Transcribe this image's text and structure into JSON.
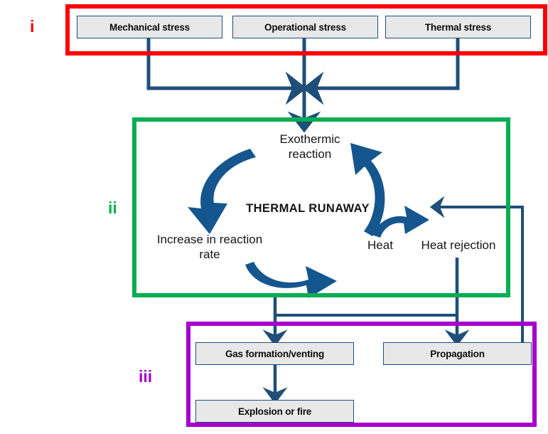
{
  "diagram": {
    "title": "Thermal runaway causes and consequences flow diagram",
    "colors": {
      "stage_i": "#fe0000",
      "stage_ii": "#09ad52",
      "stage_iii": "#a600cc",
      "connector": "#1f4e79",
      "box_fill": "#e8e8e8",
      "box_border": "#1f4e79",
      "text": "#151515"
    }
  },
  "stages": {
    "i": {
      "label": "i"
    },
    "ii": {
      "label": "ii"
    },
    "iii": {
      "label": "iii"
    }
  },
  "boxes": {
    "mechanical_stress": "Mechanical stress",
    "operational_stress": "Operational stress",
    "thermal_stress": "Thermal stress",
    "gas_formation": "Gas formation/venting",
    "propagation": "Propagation",
    "explosion": "Explosion or fire"
  },
  "cycle": {
    "center": "THERMAL  RUNAWAY",
    "exothermic": "Exothermic\nreaction",
    "exothermic_line1": "Exothermic",
    "exothermic_line2": "reaction",
    "increase_line1": "Increase  in reaction",
    "increase_line2": "rate",
    "heat": "Heat",
    "heat_rejection": "Heat rejection"
  },
  "chart_data": {
    "type": "diagram",
    "title": "Thermal runaway mechanism",
    "nodes": [
      {
        "id": "mechanical_stress",
        "label": "Mechanical stress",
        "stage": "i"
      },
      {
        "id": "operational_stress",
        "label": "Operational stress",
        "stage": "i"
      },
      {
        "id": "thermal_stress",
        "label": "Thermal stress",
        "stage": "i"
      },
      {
        "id": "exothermic",
        "label": "Exothermic reaction",
        "stage": "ii"
      },
      {
        "id": "heat",
        "label": "Heat",
        "stage": "ii"
      },
      {
        "id": "heat_rejection",
        "label": "Heat rejection",
        "stage": "ii"
      },
      {
        "id": "increase_rate",
        "label": "Increase in reaction rate",
        "stage": "ii"
      },
      {
        "id": "thermal_runaway",
        "label": "THERMAL RUNAWAY",
        "stage": "ii"
      },
      {
        "id": "gas_formation",
        "label": "Gas formation/venting",
        "stage": "iii"
      },
      {
        "id": "propagation",
        "label": "Propagation",
        "stage": "iii"
      },
      {
        "id": "explosion",
        "label": "Explosion or fire",
        "stage": "iii"
      }
    ],
    "edges": [
      {
        "from": "mechanical_stress",
        "to": "exothermic"
      },
      {
        "from": "operational_stress",
        "to": "exothermic"
      },
      {
        "from": "thermal_stress",
        "to": "exothermic"
      },
      {
        "from": "exothermic",
        "to": "heat"
      },
      {
        "from": "heat",
        "to": "increase_rate"
      },
      {
        "from": "increase_rate",
        "to": "exothermic"
      },
      {
        "from": "thermal_runaway",
        "to": "gas_formation"
      },
      {
        "from": "thermal_runaway",
        "to": "propagation"
      },
      {
        "from": "gas_formation",
        "to": "explosion"
      },
      {
        "from": "propagation",
        "to": "heat_rejection"
      }
    ]
  }
}
